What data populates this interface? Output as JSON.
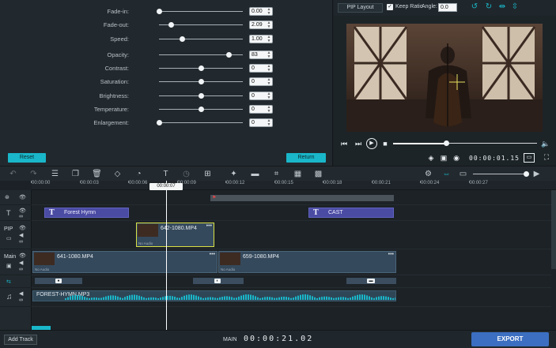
{
  "properties": {
    "rows": [
      {
        "label": "Fade-in:",
        "value": "0.00",
        "level": 0
      },
      {
        "label": "Fade-out:",
        "value": "2.09",
        "level": 0.14
      },
      {
        "label": "Speed:",
        "value": "1.00",
        "level": 0.27
      },
      {
        "label": "Opacity:",
        "value": "83",
        "level": 0.83
      },
      {
        "label": "Contrast:",
        "value": "0",
        "level": 0.5
      },
      {
        "label": "Saturation:",
        "value": "0",
        "level": 0.5
      },
      {
        "label": "Brightness:",
        "value": "0",
        "level": 0.5
      },
      {
        "label": "Temperature:",
        "value": "0",
        "level": 0.5
      },
      {
        "label": "Enlargement:",
        "value": "0",
        "level": 0
      }
    ],
    "reset_label": "Reset",
    "return_label": "Return"
  },
  "preview": {
    "pip_layout_label": "PIP Layout",
    "keep_ratio_label": "Keep Ratio",
    "keep_ratio_checked": true,
    "angle_label": "Angle:",
    "angle_value": "0.0",
    "timecode": "00:00:01.15",
    "seek_progress": 0.37
  },
  "ruler": {
    "ticks": [
      "00:00:00",
      "00:00:03",
      "00:00:06",
      "00:00:09",
      "00:00:12",
      "00:00:15",
      "00:00:18",
      "00:00:21",
      "00:00:24",
      "00:00:27"
    ],
    "playhead_time": "00:00:07"
  },
  "tracks": {
    "pip_label": "PIP",
    "main_label": "Main"
  },
  "clips": {
    "title1": "Forest Hymn",
    "title2": "CAST",
    "pip_clip": "642-1080.MP4",
    "main1": "641-1080.MP4",
    "main2": "659-1080.MP4",
    "no_audio": "No Audio",
    "audio": "FOREST-HYMN.MP3"
  },
  "bottom": {
    "add_track": "Add Track",
    "main_label": "MAIN",
    "main_time": "00:00:21.02",
    "export": "EXPORT"
  },
  "colors": {
    "accent": "#19b7c9",
    "export": "#3c6fc1",
    "title_clip": "#4a4ba3",
    "pip_selection": "#d8e043"
  }
}
